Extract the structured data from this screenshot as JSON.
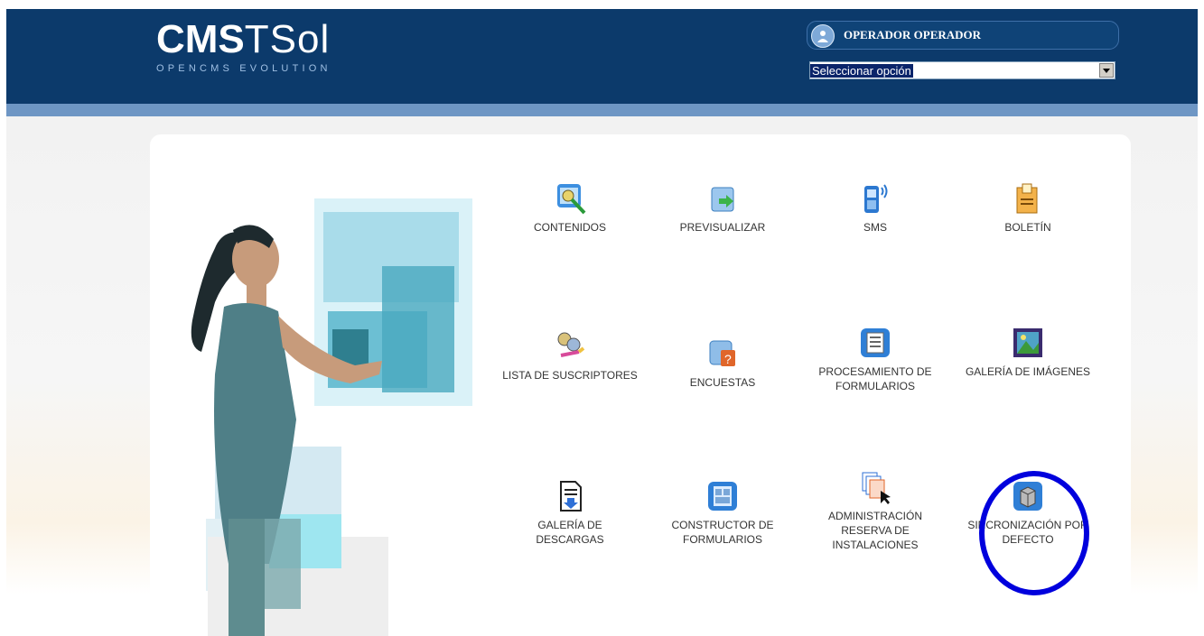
{
  "header": {
    "logo_main_bold": "CMS",
    "logo_main_thin": "TSol",
    "logo_sub": "OPENCMS EVOLUTION",
    "user_name": "OPERADOR OPERADOR",
    "select_value": "Seleccionar opción"
  },
  "menu": [
    {
      "label": "CONTENIDOS",
      "icon": "contents-icon"
    },
    {
      "label": "PREVISUALIZAR",
      "icon": "preview-icon"
    },
    {
      "label": "SMS",
      "icon": "sms-phone-icon"
    },
    {
      "label": "BOLETÍN",
      "icon": "newsletter-icon"
    },
    {
      "label": "LISTA DE SUSCRIPTORES",
      "icon": "subscribers-icon"
    },
    {
      "label": "ENCUESTAS",
      "icon": "survey-icon"
    },
    {
      "label": "PROCESAMIENTO DE FORMULARIOS",
      "icon": "form-processing-icon"
    },
    {
      "label": "GALERÍA DE IMÁGENES",
      "icon": "image-gallery-icon"
    },
    {
      "label": "GALERÍA DE DESCARGAS",
      "icon": "download-gallery-icon"
    },
    {
      "label": "CONSTRUCTOR DE FORMULARIOS",
      "icon": "form-builder-icon"
    },
    {
      "label": "ADMINISTRACIÓN RESERVA DE INSTALACIONES",
      "icon": "booking-admin-icon"
    },
    {
      "label": "SINCRONIZACIÓN POR DEFECTO",
      "icon": "sync-default-icon"
    }
  ],
  "colors": {
    "header": "#0c3a6b",
    "highlight_circle": "#0000dd"
  }
}
